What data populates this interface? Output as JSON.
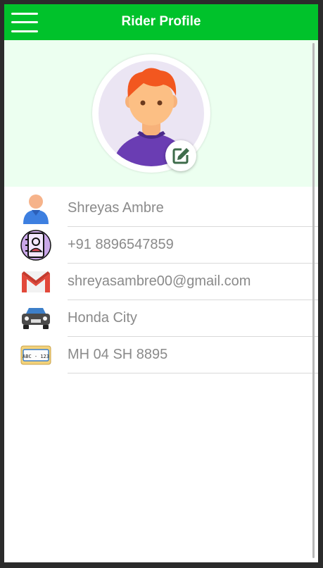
{
  "appbar": {
    "title": "Rider Profile",
    "menu_icon": "hamburger-menu-icon"
  },
  "profile": {
    "avatar_icon": "person-avatar-icon",
    "edit_icon": "edit-pencil-icon"
  },
  "details": [
    {
      "icon": "user-icon",
      "value": "Shreyas Ambre"
    },
    {
      "icon": "phone-contact-icon",
      "value": "+91 8896547859"
    },
    {
      "icon": "gmail-icon",
      "value": "shreyasambre00@gmail.com"
    },
    {
      "icon": "car-icon",
      "value": "Honda City"
    },
    {
      "icon": "license-plate-icon",
      "value": "MH 04 SH 8895"
    }
  ],
  "colors": {
    "appbar": "#00c22b",
    "header_bg": "#ecfff0",
    "text": "#8a8a8a",
    "edit_icon": "#3d6b4a"
  }
}
